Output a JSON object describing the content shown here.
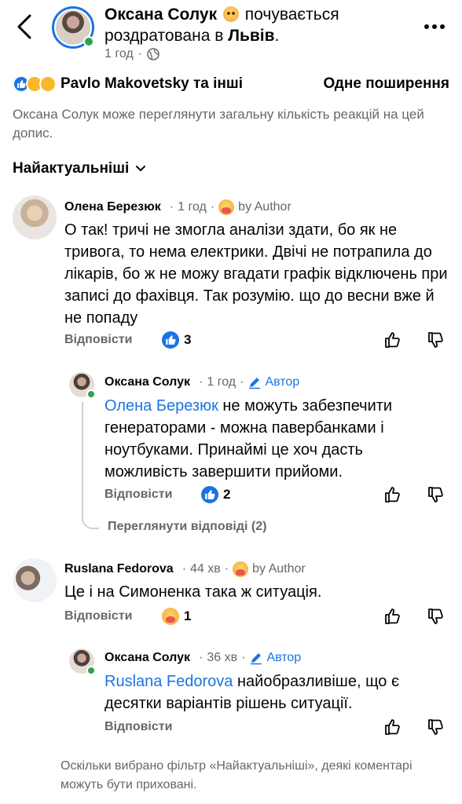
{
  "post_header": {
    "author": "Оксана Солук",
    "feeling": "почувається",
    "feeling_line2_prefix": "роздратована в",
    "location": "Львів",
    "location_suffix": ".",
    "time": "1 год",
    "separator": "·"
  },
  "reactions": {
    "names": "Pavlo Makovetsky та інші",
    "shares": "Одне поширення"
  },
  "privacy_note": "Оксана Солук може переглянути загальну кількість реакцій на цей допис.",
  "sort": {
    "label": "Найактуальніші"
  },
  "comments": [
    {
      "name": "Олена Березюк",
      "time": "1 год",
      "tag": "by Author",
      "text": "О так! тричі не змогла аналізи здати, бо як не тривога, то нема електрики. Двічі не потрапила до лікарів, бо ж не можу вгадати графік відключень при записі до фахівця. Так розумію. що до весни вже й не попаду",
      "reply_label": "Відповісти",
      "reaction_count": "3"
    },
    {
      "name": "Оксана Солук",
      "time": "1 год",
      "tag": "Автор",
      "mention": "Олена Березюк",
      "text": " не можуть забезпечити генераторами - можна павербанками і ноутбуками. Принаймі це хоч дасть можливість завершити прийоми.",
      "reply_label": "Відповісти",
      "reaction_count": "2"
    },
    {
      "name": "Ruslana Fedorova",
      "time": "44 хв",
      "tag": "by Author",
      "text": "Це і на Симоненка така ж ситуація.",
      "reply_label": "Відповісти",
      "reaction_count": "1"
    },
    {
      "name": "Оксана Солук",
      "time": "36 хв",
      "tag": "Автор",
      "mention": "Ruslana Fedorova",
      "text": " найобразливіше, що є десятки варіантів рішень ситуації.",
      "reply_label": "Відповісти"
    }
  ],
  "view_replies": "Переглянути відповіді (2)",
  "footer_note": "Оскільки вибрано фільтр «Найактуальніші», деякі коментарі можуть бути приховані.",
  "colors": {
    "accent": "#1b74e4",
    "muted": "#65676b",
    "online": "#31a24c"
  }
}
